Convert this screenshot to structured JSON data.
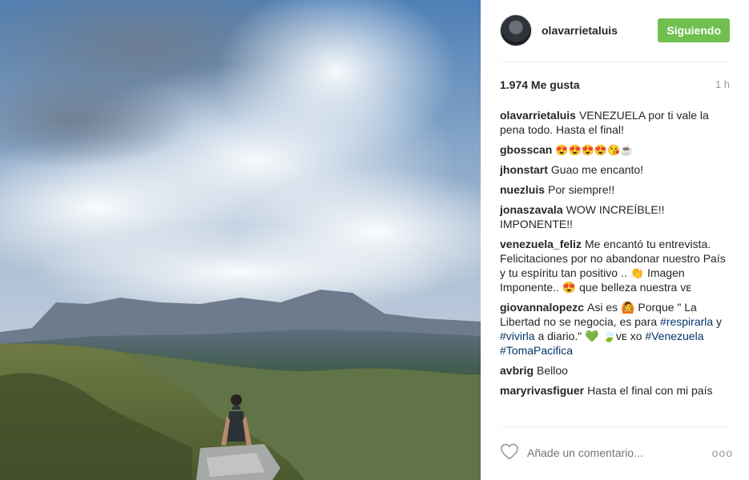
{
  "post": {
    "username": "olavarrietaluis",
    "follow_label": "Siguiendo",
    "likes": "1.974 Me gusta",
    "time": "1 h",
    "add_comment_placeholder": "Añade un comentario...",
    "more_label": "ooo"
  },
  "comments": [
    {
      "user": "olavarrietaluis",
      "text": "VENEZUELA por ti vale la pena todo. Hasta el final!"
    },
    {
      "user": "gbosscan",
      "text": "😍😍😍😍😘☕"
    },
    {
      "user": "jhonstart",
      "text": "Guao me encanto!"
    },
    {
      "user": "nuezluis",
      "text": "Por siempre!!"
    },
    {
      "user": "jonaszavala",
      "text": "WOW INCREÍBLE!! IMPONENTE!!"
    },
    {
      "user": "venezuela_feliz",
      "text": "Me encantó tu entrevista. Felicitaciones por no abandonar nuestro País y tu espíritu tan positivo .. 👏 Imagen Imponente.. 😍 que belleza nuestra ᴠᴇ"
    },
    {
      "user": "giovannalopezc",
      "text_a": "Asi es 🙆 Porque \" La Libertad no se negocia, es para ",
      "tag1": "#respirarla",
      "text_b": " y ",
      "tag2": "#vivirla",
      "text_c": " a diario.\" 💚 🍃ᴠᴇ xo ",
      "tag3": "#Venezuela",
      "text_d": " ",
      "tag4": "#TomaPacifica"
    },
    {
      "user": "avbrig",
      "text": "Belloo"
    },
    {
      "user": "maryrivasfiguer",
      "text": "Hasta el final con mi país"
    }
  ],
  "icons": {
    "heart": "heart-outline-icon",
    "more": "more-options-icon",
    "avatar": "user-avatar"
  },
  "colors": {
    "follow_button": "#70c050",
    "hashtag": "#003569",
    "muted": "#999999"
  }
}
